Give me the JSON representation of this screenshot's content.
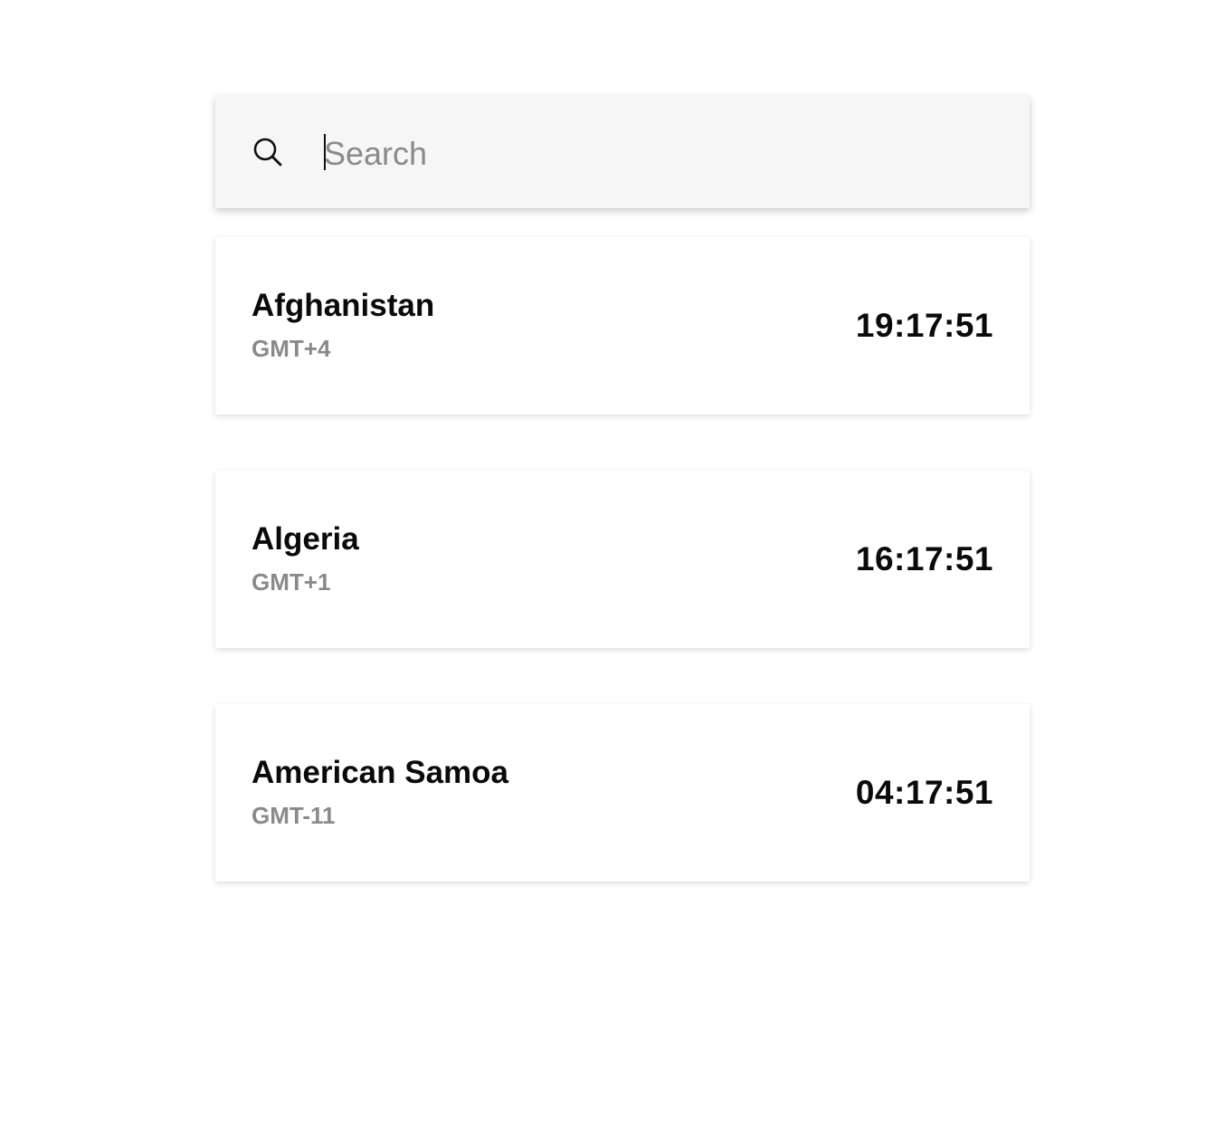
{
  "search": {
    "placeholder": "Search",
    "value": "",
    "icon": "search-icon"
  },
  "timezones": [
    {
      "country": "Afghanistan",
      "offset": "GMT+4",
      "time": "19:17:51"
    },
    {
      "country": "Algeria",
      "offset": "GMT+1",
      "time": "16:17:51"
    },
    {
      "country": "American Samoa",
      "offset": "GMT-11",
      "time": "04:17:51"
    }
  ],
  "colors": {
    "search_bg": "#f6f6f6",
    "card_bg": "#ffffff",
    "primary_text": "#0a0a0a",
    "secondary_text": "#8a8a8a"
  }
}
